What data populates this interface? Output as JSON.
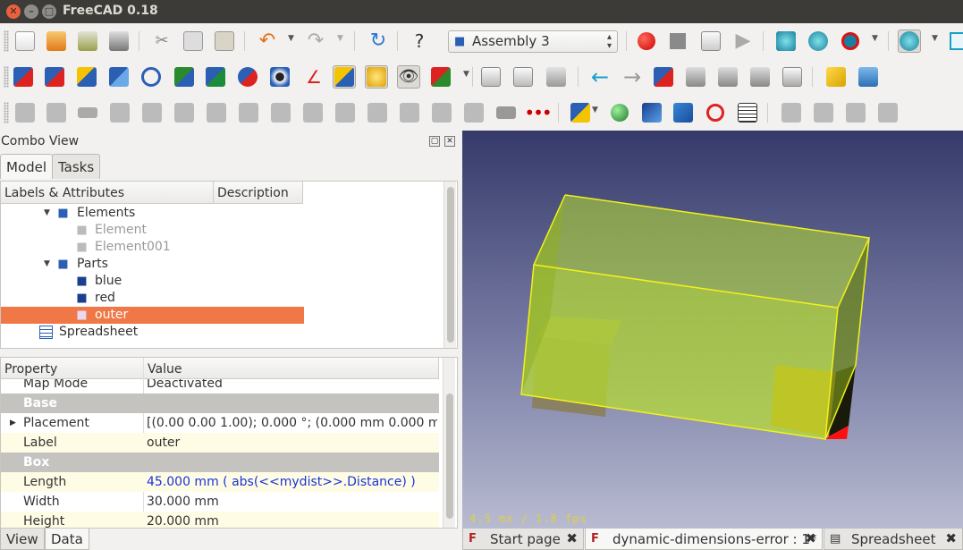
{
  "window": {
    "title": "FreeCAD 0.18",
    "close_glyph": "✕",
    "minimize_glyph": "–",
    "maximize_glyph": "□"
  },
  "toolbar": {
    "workbench": "Assembly 3"
  },
  "combo_view": {
    "title": "Combo View",
    "tabs": [
      "Model",
      "Tasks"
    ],
    "tree_headers": [
      "Labels & Attributes",
      "Description"
    ],
    "tree_items": [
      {
        "label": "Elements",
        "icon": "assembly-icon",
        "dim": false
      },
      {
        "label": "Element",
        "icon": "element-icon",
        "dim": true
      },
      {
        "label": "Element001",
        "icon": "element-icon",
        "dim": true
      },
      {
        "label": "Parts",
        "icon": "assembly-icon",
        "dim": false
      },
      {
        "label": "blue",
        "icon": "box-icon",
        "dim": false
      },
      {
        "label": "red",
        "icon": "box-icon",
        "dim": false
      },
      {
        "label": "outer",
        "icon": "box-icon",
        "dim": false
      },
      {
        "label": "Spreadsheet",
        "icon": "spreadsheet-icon",
        "dim": false
      }
    ],
    "selected_item": "outer",
    "property_headers": [
      "Property",
      "Value"
    ],
    "properties": [
      {
        "name": "Map Mode",
        "value": "Deactivated"
      },
      {
        "group": "Base"
      },
      {
        "name": "Placement",
        "value": "[(0.00 0.00 1.00); 0.000 °; (0.000 mm  0.000 m…"
      },
      {
        "name": "Label",
        "value": "outer"
      },
      {
        "group": "Box"
      },
      {
        "name": "Length",
        "value": "45.000 mm  ( abs(<<mydist>>.Distance) )"
      },
      {
        "name": "Width",
        "value": "30.000 mm"
      },
      {
        "name": "Height",
        "value": "20.000 mm"
      }
    ],
    "bottom_tabs": [
      "View",
      "Data"
    ]
  },
  "view3d": {
    "fps_text": "4.5 ms / 1.8 fps",
    "outer_box_color": "#b8e02e",
    "edge_color": "#f3f21a",
    "inner_box_left_color": "#8a7f5a",
    "inner_box_right_color": "#c8861a",
    "red_face_color": "#ff1010"
  },
  "doc_tabs": [
    {
      "label": "Start page",
      "icon": "freecad-icon"
    },
    {
      "label": "dynamic-dimensions-error : 1*",
      "icon": "freecad-icon"
    },
    {
      "label": "Spreadsheet",
      "icon": "spreadsheet-icon"
    }
  ],
  "close_glyph": "✖"
}
